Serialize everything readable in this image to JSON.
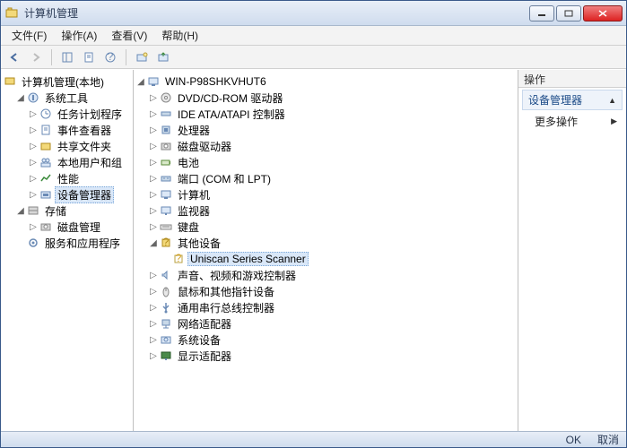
{
  "window": {
    "title": "计算机管理"
  },
  "menu": {
    "file": "文件(F)",
    "action": "操作(A)",
    "view": "查看(V)",
    "help": "帮助(H)"
  },
  "left_tree": {
    "root": "计算机管理(本地)",
    "groups": [
      {
        "label": "系统工具",
        "expanded": true,
        "children": [
          "任务计划程序",
          "事件查看器",
          "共享文件夹",
          "本地用户和组",
          "性能",
          "设备管理器"
        ]
      },
      {
        "label": "存储",
        "expanded": true,
        "children": [
          "磁盘管理"
        ]
      },
      {
        "label": "服务和应用程序",
        "expanded": false,
        "children": []
      }
    ],
    "selected": "设备管理器"
  },
  "center_tree": {
    "root": "WIN-P98SHKVHUT6",
    "items": [
      {
        "label": "DVD/CD-ROM 驱动器",
        "icon": "cd"
      },
      {
        "label": "IDE ATA/ATAPI 控制器",
        "icon": "ide"
      },
      {
        "label": "处理器",
        "icon": "cpu"
      },
      {
        "label": "磁盘驱动器",
        "icon": "disk"
      },
      {
        "label": "电池",
        "icon": "battery"
      },
      {
        "label": "端口 (COM 和 LPT)",
        "icon": "port"
      },
      {
        "label": "计算机",
        "icon": "computer"
      },
      {
        "label": "监视器",
        "icon": "monitor"
      },
      {
        "label": "键盘",
        "icon": "keyboard"
      },
      {
        "label": "其他设备",
        "icon": "other",
        "expanded": true,
        "children": [
          {
            "label": "Uniscan Series Scanner",
            "icon": "unknown",
            "selected": true
          }
        ]
      },
      {
        "label": "声音、视频和游戏控制器",
        "icon": "sound"
      },
      {
        "label": "鼠标和其他指针设备",
        "icon": "mouse"
      },
      {
        "label": "通用串行总线控制器",
        "icon": "usb"
      },
      {
        "label": "网络适配器",
        "icon": "network"
      },
      {
        "label": "系统设备",
        "icon": "system"
      },
      {
        "label": "显示适配器",
        "icon": "display"
      }
    ]
  },
  "actions": {
    "header": "操作",
    "subheader": "设备管理器",
    "more": "更多操作"
  },
  "status": {
    "ok": "OK",
    "cancel": "取消"
  }
}
